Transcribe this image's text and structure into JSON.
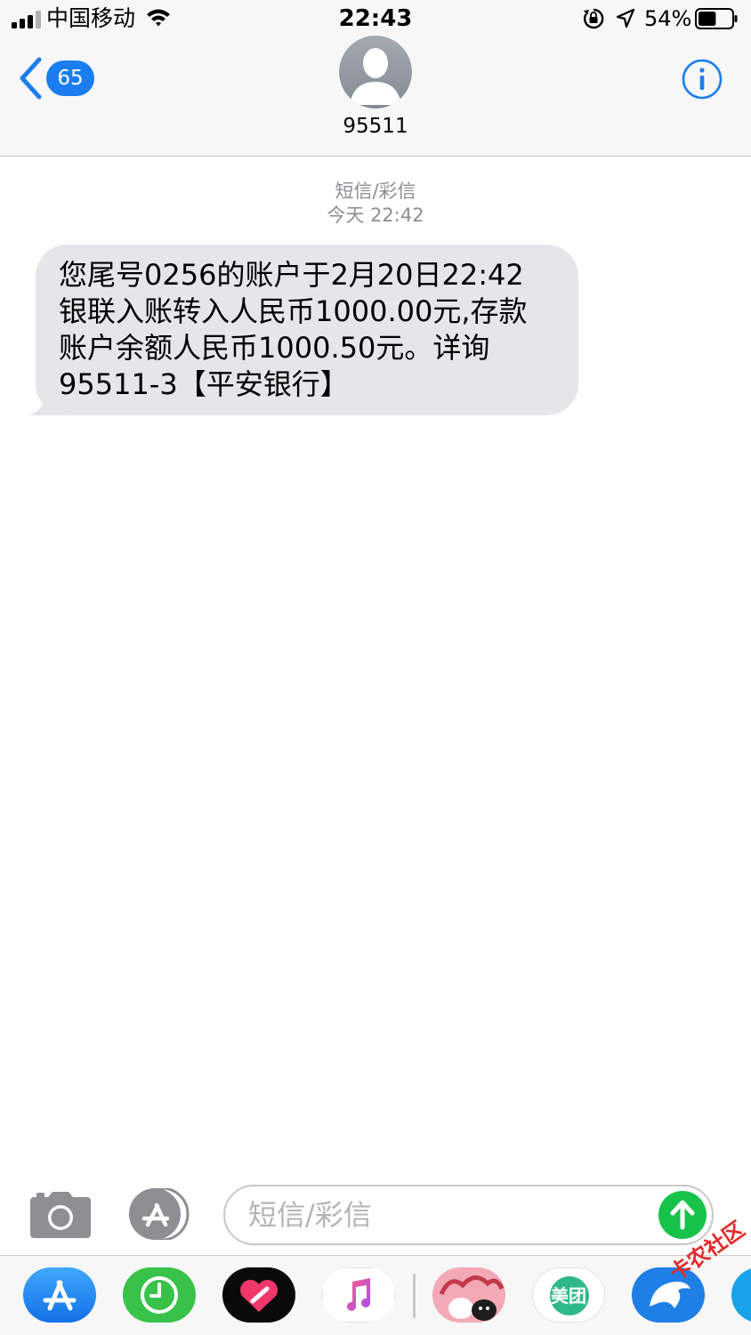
{
  "status_bar": {
    "carrier": "中国移动",
    "time": "22:43",
    "battery_percent": "54%",
    "battery_level": 0.54,
    "icons": [
      "signal-icon",
      "wifi-icon",
      "orientation-lock-icon",
      "location-icon",
      "battery-icon"
    ]
  },
  "header": {
    "back_count": "65",
    "contact_name": "95511",
    "accent": "#1a7ef0"
  },
  "conversation": {
    "type_label": "短信/彩信",
    "timestamp": "今天 22:42",
    "messages": [
      {
        "direction": "incoming",
        "text": "您尾号0256的账户于2月20日22:42\n银联入账转入人民币1000.00元,存款\n账户余额人民币1000.50元。详询\n95511-3【平安银行】"
      }
    ]
  },
  "input_bar": {
    "placeholder": "短信/彩信",
    "send_color": "#17c24a"
  },
  "app_drawer": {
    "apps": [
      {
        "icon": "app-store-icon"
      },
      {
        "icon": "clock-app-icon"
      },
      {
        "icon": "heart-app-icon"
      },
      {
        "icon": "music-icon"
      },
      {
        "icon": "sticker-app-icon"
      },
      {
        "icon": "meituan-icon",
        "label": "美团"
      },
      {
        "icon": "dolphin-app-icon"
      }
    ]
  },
  "watermark": "卡农社区"
}
